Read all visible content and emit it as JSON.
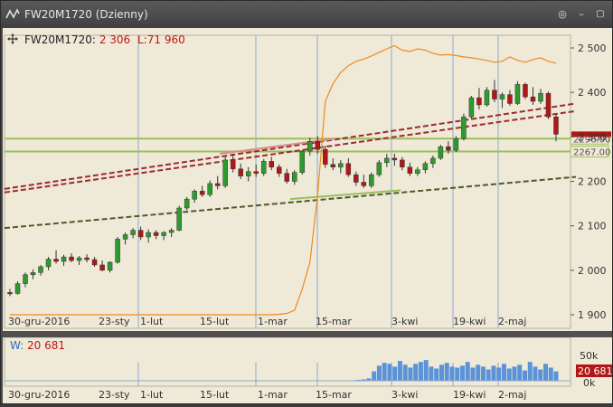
{
  "window": {
    "title": "FW20M1720 (Dzienny)",
    "controls": [
      "◎",
      "–",
      "▢",
      "✕"
    ]
  },
  "header": {
    "move_icon": "move-arrows-icon",
    "symbol": "FW20M1720:",
    "last_value": "2 306",
    "low_label": "L:",
    "low_value": "71 960"
  },
  "price_axis": {
    "ticks": [
      "2 500",
      "2 400",
      "2 300",
      "2 200",
      "2 100",
      "2 000",
      "1 900"
    ],
    "level_labels": [
      "2296.00",
      "2267.00"
    ]
  },
  "date_axis": {
    "ticks": [
      "30-gru-2016",
      "23-sty",
      "1-lut",
      "15-lut",
      "1-mar",
      "15-mar",
      "3-kwi",
      "19-kwi",
      "2-maj"
    ]
  },
  "volume_panel": {
    "label": "W:",
    "value": "20 681",
    "ticks": [
      "50k",
      "0k"
    ],
    "current_badge": "20 681"
  },
  "colors": {
    "up_candle": "#2e9b2e",
    "down_candle": "#b01818",
    "open_interest_line": "#f08a1c",
    "level_line": "#9dbe5c",
    "channel_dashed": "#9a2c2c",
    "support_dashed": "#4e5a2a",
    "volume_bar": "#5b92d8",
    "background": "#efe9d8"
  },
  "chart_data": {
    "type": "candlestick",
    "ylim": [
      1900,
      2500
    ],
    "horizontal_levels": [
      2296.0,
      2267.0
    ],
    "candles": [
      {
        "o": 1950,
        "h": 1958,
        "l": 1942,
        "c": 1948
      },
      {
        "o": 1948,
        "h": 1975,
        "l": 1945,
        "c": 1970
      },
      {
        "o": 1970,
        "h": 1995,
        "l": 1962,
        "c": 1990
      },
      {
        "o": 1990,
        "h": 2002,
        "l": 1980,
        "c": 1995
      },
      {
        "o": 1995,
        "h": 2012,
        "l": 1988,
        "c": 2008
      },
      {
        "o": 2008,
        "h": 2030,
        "l": 2000,
        "c": 2025
      },
      {
        "o": 2025,
        "h": 2045,
        "l": 2015,
        "c": 2020
      },
      {
        "o": 2020,
        "h": 2035,
        "l": 2010,
        "c": 2030
      },
      {
        "o": 2030,
        "h": 2038,
        "l": 2018,
        "c": 2022
      },
      {
        "o": 2022,
        "h": 2032,
        "l": 2012,
        "c": 2028
      },
      {
        "o": 2028,
        "h": 2036,
        "l": 2018,
        "c": 2024
      },
      {
        "o": 2024,
        "h": 2030,
        "l": 2008,
        "c": 2012
      },
      {
        "o": 2012,
        "h": 2022,
        "l": 1998,
        "c": 2000
      },
      {
        "o": 2000,
        "h": 2020,
        "l": 1995,
        "c": 2018
      },
      {
        "o": 2018,
        "h": 2075,
        "l": 2015,
        "c": 2070
      },
      {
        "o": 2070,
        "h": 2085,
        "l": 2058,
        "c": 2080
      },
      {
        "o": 2080,
        "h": 2095,
        "l": 2072,
        "c": 2090
      },
      {
        "o": 2090,
        "h": 2098,
        "l": 2068,
        "c": 2075
      },
      {
        "o": 2075,
        "h": 2092,
        "l": 2062,
        "c": 2085
      },
      {
        "o": 2085,
        "h": 2090,
        "l": 2070,
        "c": 2078
      },
      {
        "o": 2078,
        "h": 2088,
        "l": 2068,
        "c": 2085
      },
      {
        "o": 2085,
        "h": 2095,
        "l": 2075,
        "c": 2090
      },
      {
        "o": 2090,
        "h": 2145,
        "l": 2088,
        "c": 2140
      },
      {
        "o": 2140,
        "h": 2165,
        "l": 2135,
        "c": 2160
      },
      {
        "o": 2160,
        "h": 2182,
        "l": 2152,
        "c": 2178
      },
      {
        "o": 2178,
        "h": 2190,
        "l": 2165,
        "c": 2170
      },
      {
        "o": 2170,
        "h": 2202,
        "l": 2165,
        "c": 2195
      },
      {
        "o": 2195,
        "h": 2212,
        "l": 2182,
        "c": 2190
      },
      {
        "o": 2190,
        "h": 2255,
        "l": 2185,
        "c": 2248
      },
      {
        "o": 2248,
        "h": 2262,
        "l": 2220,
        "c": 2228
      },
      {
        "o": 2228,
        "h": 2240,
        "l": 2205,
        "c": 2212
      },
      {
        "o": 2212,
        "h": 2232,
        "l": 2200,
        "c": 2222
      },
      {
        "o": 2222,
        "h": 2238,
        "l": 2210,
        "c": 2218
      },
      {
        "o": 2218,
        "h": 2250,
        "l": 2212,
        "c": 2245
      },
      {
        "o": 2245,
        "h": 2255,
        "l": 2225,
        "c": 2232
      },
      {
        "o": 2232,
        "h": 2238,
        "l": 2210,
        "c": 2218
      },
      {
        "o": 2218,
        "h": 2228,
        "l": 2195,
        "c": 2200
      },
      {
        "o": 2200,
        "h": 2225,
        "l": 2192,
        "c": 2220
      },
      {
        "o": 2220,
        "h": 2270,
        "l": 2215,
        "c": 2268
      },
      {
        "o": 2268,
        "h": 2298,
        "l": 2258,
        "c": 2290
      },
      {
        "o": 2290,
        "h": 2302,
        "l": 2262,
        "c": 2272
      },
      {
        "o": 2272,
        "h": 2280,
        "l": 2230,
        "c": 2238
      },
      {
        "o": 2238,
        "h": 2252,
        "l": 2225,
        "c": 2232
      },
      {
        "o": 2232,
        "h": 2248,
        "l": 2218,
        "c": 2240
      },
      {
        "o": 2240,
        "h": 2252,
        "l": 2210,
        "c": 2215
      },
      {
        "o": 2215,
        "h": 2222,
        "l": 2190,
        "c": 2198
      },
      {
        "o": 2198,
        "h": 2215,
        "l": 2185,
        "c": 2190
      },
      {
        "o": 2190,
        "h": 2220,
        "l": 2185,
        "c": 2215
      },
      {
        "o": 2215,
        "h": 2248,
        "l": 2210,
        "c": 2242
      },
      {
        "o": 2242,
        "h": 2262,
        "l": 2232,
        "c": 2252
      },
      {
        "o": 2252,
        "h": 2262,
        "l": 2235,
        "c": 2248
      },
      {
        "o": 2248,
        "h": 2255,
        "l": 2225,
        "c": 2232
      },
      {
        "o": 2232,
        "h": 2242,
        "l": 2212,
        "c": 2218
      },
      {
        "o": 2218,
        "h": 2232,
        "l": 2212,
        "c": 2226
      },
      {
        "o": 2226,
        "h": 2245,
        "l": 2218,
        "c": 2240
      },
      {
        "o": 2240,
        "h": 2258,
        "l": 2230,
        "c": 2252
      },
      {
        "o": 2252,
        "h": 2282,
        "l": 2248,
        "c": 2278
      },
      {
        "o": 2278,
        "h": 2290,
        "l": 2262,
        "c": 2270
      },
      {
        "o": 2270,
        "h": 2302,
        "l": 2266,
        "c": 2296
      },
      {
        "o": 2296,
        "h": 2352,
        "l": 2292,
        "c": 2345
      },
      {
        "o": 2345,
        "h": 2392,
        "l": 2340,
        "c": 2388
      },
      {
        "o": 2388,
        "h": 2410,
        "l": 2362,
        "c": 2372
      },
      {
        "o": 2372,
        "h": 2412,
        "l": 2368,
        "c": 2405
      },
      {
        "o": 2405,
        "h": 2428,
        "l": 2378,
        "c": 2385
      },
      {
        "o": 2385,
        "h": 2400,
        "l": 2365,
        "c": 2395
      },
      {
        "o": 2395,
        "h": 2405,
        "l": 2370,
        "c": 2375
      },
      {
        "o": 2375,
        "h": 2425,
        "l": 2372,
        "c": 2418
      },
      {
        "o": 2418,
        "h": 2422,
        "l": 2385,
        "c": 2390
      },
      {
        "o": 2390,
        "h": 2412,
        "l": 2372,
        "c": 2380
      },
      {
        "o": 2380,
        "h": 2408,
        "l": 2374,
        "c": 2398
      },
      {
        "o": 2398,
        "h": 2402,
        "l": 2340,
        "c": 2345
      },
      {
        "o": 2345,
        "h": 2352,
        "l": 2290,
        "c": 2306
      }
    ],
    "open_interest": [
      2,
      2,
      2,
      2,
      2,
      2,
      2,
      2,
      2,
      2,
      2,
      2,
      2,
      2,
      2,
      2,
      2,
      2,
      2,
      2,
      2,
      2,
      2,
      2,
      2,
      2,
      2,
      2,
      2,
      2,
      2,
      2,
      2,
      2,
      2,
      3,
      5,
      12,
      60,
      120,
      270,
      480,
      520,
      545,
      560,
      570,
      575,
      582,
      590,
      598,
      605,
      595,
      592,
      598,
      595,
      588,
      584,
      585,
      583,
      580,
      578,
      575,
      572,
      568,
      570,
      580,
      572,
      568,
      574,
      578,
      570,
      566
    ],
    "volume": [
      0,
      0,
      0,
      0,
      0,
      0,
      0,
      0,
      0,
      0,
      0,
      0,
      0,
      0,
      0,
      0,
      0,
      0,
      0,
      0,
      0,
      0,
      0,
      0,
      0,
      0,
      0,
      0,
      0,
      0,
      0,
      0,
      0,
      0,
      0,
      0,
      0,
      0,
      0,
      0,
      0,
      0,
      0,
      0,
      0,
      0,
      0,
      0,
      0,
      0,
      0,
      0,
      0,
      0,
      0,
      0,
      0,
      0,
      0,
      0,
      0,
      0,
      0,
      0,
      0,
      0,
      1,
      2,
      3,
      5,
      20,
      32,
      38,
      36,
      30,
      42,
      34,
      28,
      36,
      40,
      44,
      30,
      26,
      34,
      38,
      30,
      28,
      32,
      40,
      28,
      34,
      30,
      24,
      32,
      28,
      36,
      26,
      30,
      34,
      22,
      40,
      30,
      24,
      36,
      28,
      20
    ]
  }
}
